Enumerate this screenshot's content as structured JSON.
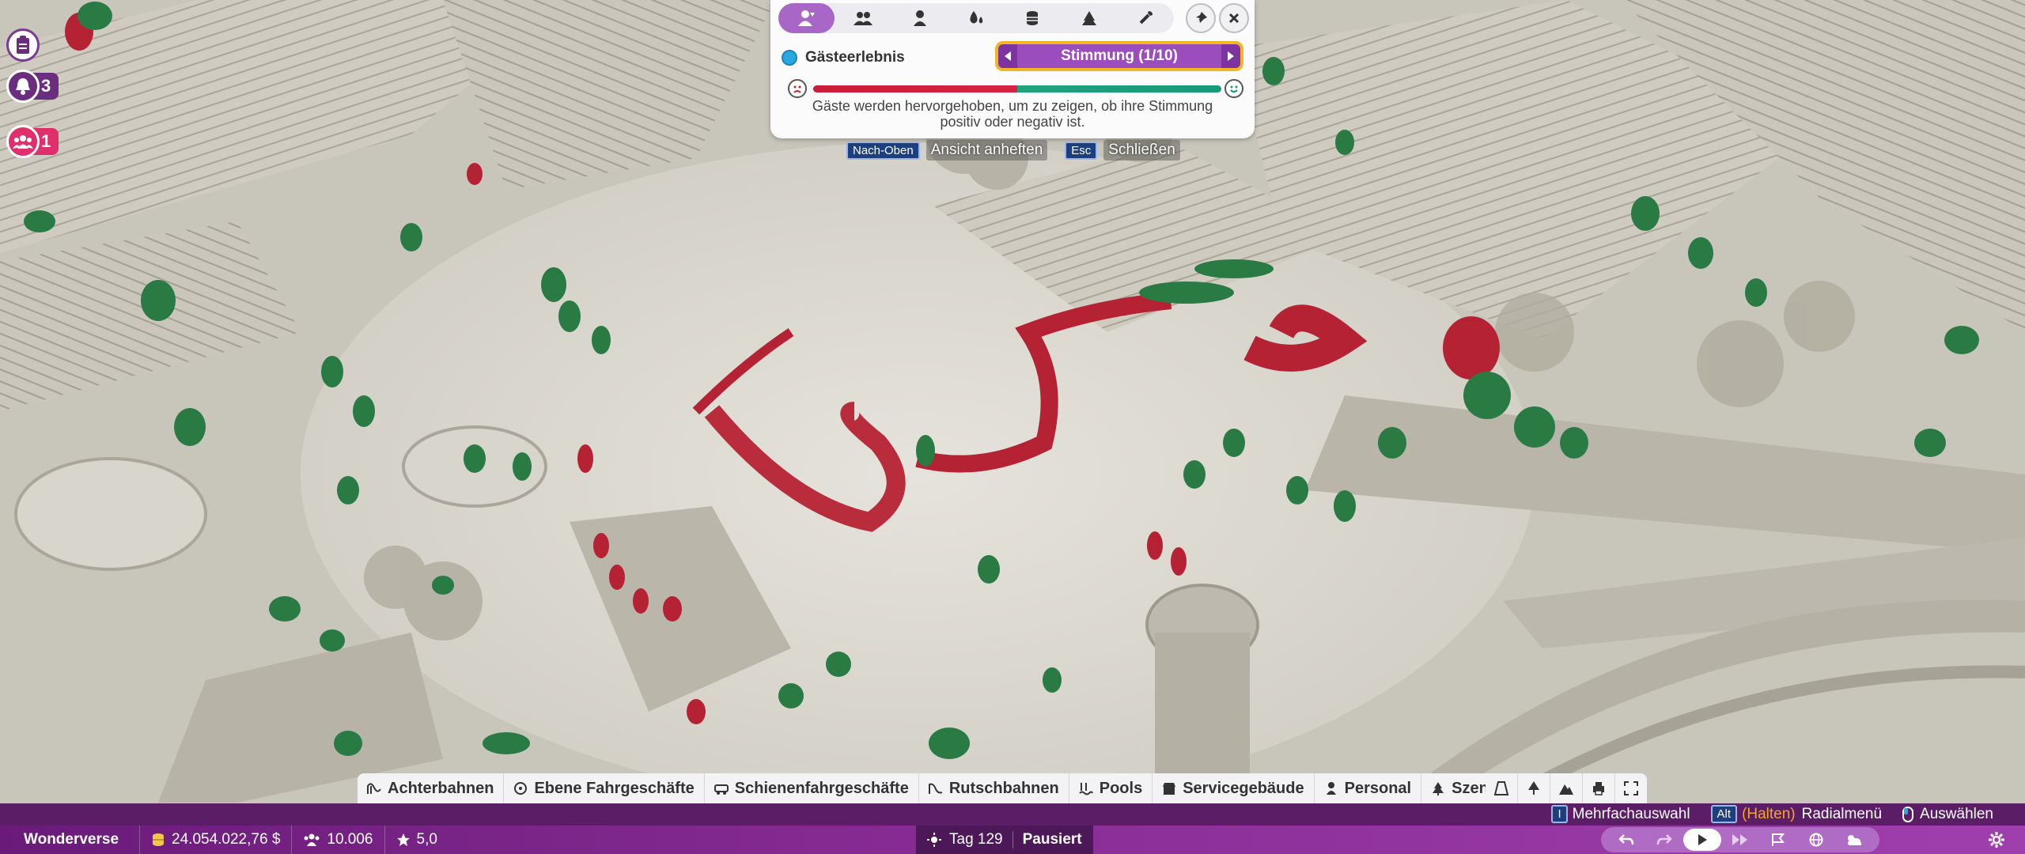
{
  "overlay": {
    "mode_tabs": [
      {
        "icon": "guest-mood-icon",
        "active": true
      },
      {
        "icon": "group-icon"
      },
      {
        "icon": "person-icon"
      },
      {
        "icon": "drops-icon"
      },
      {
        "icon": "coins-icon"
      },
      {
        "icon": "scenery-icon"
      },
      {
        "icon": "wrench-icon"
      }
    ],
    "pin_icon": "pin-icon",
    "close_icon": "close-icon",
    "layer_name": "Gästeerlebnis",
    "selector_label": "Stimmung (1/10)",
    "legend_line1": "Gäste werden hervorgehoben, um zu zeigen, ob ihre Stimmung",
    "legend_line2": "positiv oder negativ ist.",
    "colors": {
      "negative": "#d42343",
      "positive": "#20a37d",
      "accent": "#9b4dbd",
      "highlight": "#f3b425"
    }
  },
  "panel_hints": {
    "pin_key": "Nach-Oben",
    "pin_label": "Ansicht anheften",
    "close_key": "Esc",
    "close_label": "Schließen"
  },
  "left_buttons": {
    "notifications_count": "3",
    "guests_count": "1"
  },
  "categories": [
    {
      "label": "Achterbahnen",
      "icon": "coaster-icon"
    },
    {
      "label": "Ebene Fahrgeschäfte",
      "icon": "flat-ride-icon"
    },
    {
      "label": "Schienenfahrgeschäfte",
      "icon": "track-ride-icon"
    },
    {
      "label": "Rutschbahnen",
      "icon": "slide-icon"
    },
    {
      "label": "Pools",
      "icon": "pool-icon"
    },
    {
      "label": "Servicegebäude",
      "icon": "shop-icon"
    },
    {
      "label": "Personal",
      "icon": "staff-icon"
    },
    {
      "label": "Szenerie",
      "icon": "scenery-icon"
    }
  ],
  "hints": {
    "multi_key": "I",
    "multi_label": "Mehrfachauswahl",
    "alt_key": "Alt",
    "hold_label": "(Halten)",
    "radial_label": "Radialmenü",
    "select_label": "Auswählen"
  },
  "status": {
    "park_name": "Wonderverse",
    "money": "24.054.022,76 $",
    "guests": "10.006",
    "rating": "5,0",
    "day": "Tag 129",
    "state": "Pausiert"
  }
}
